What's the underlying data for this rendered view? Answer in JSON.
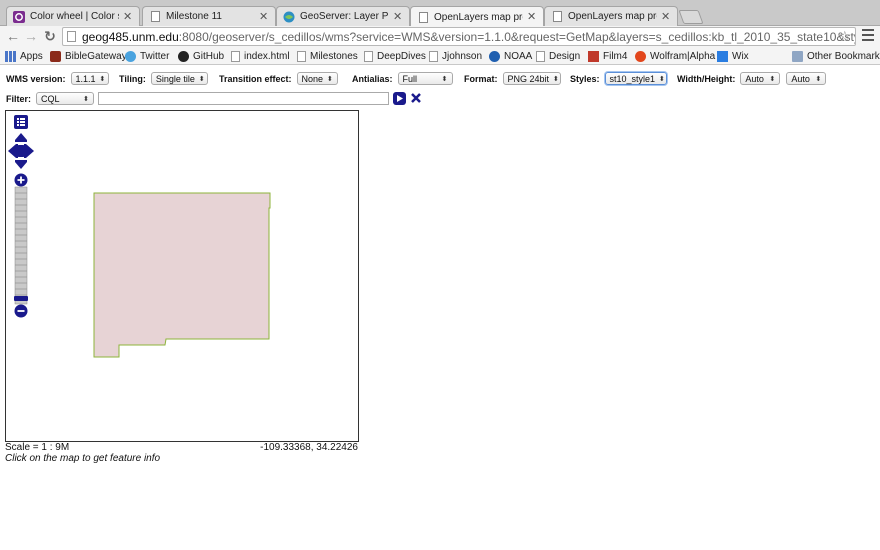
{
  "tabs": [
    {
      "title": "Color wheel | Color scheme",
      "icon": "color-wheel-icon",
      "active": false
    },
    {
      "title": "Milestone 11",
      "icon": "document-icon",
      "active": false
    },
    {
      "title": "GeoServer: Layer Preview",
      "icon": "geoserver-icon",
      "active": false
    },
    {
      "title": "OpenLayers map preview",
      "icon": "document-icon",
      "active": true
    },
    {
      "title": "OpenLayers map preview",
      "icon": "document-icon",
      "active": false
    }
  ],
  "toolbar": {
    "url_host": "geog485.unm.edu",
    "url_rest": ":8080/geoserver/s_cedillos/wms?service=WMS&version=1.1.0&request=GetMap&layers=s_cedillos:kb_tl_2010_35_state10&styles=&bbox=..."
  },
  "bookmarks": [
    {
      "label": "Apps",
      "icon": "apps-icon"
    },
    {
      "label": "BibleGateway",
      "icon": "biblegateway-icon"
    },
    {
      "label": "Twitter",
      "icon": "twitter-icon"
    },
    {
      "label": "GitHub",
      "icon": "github-icon"
    },
    {
      "label": "index.html",
      "icon": "document-icon"
    },
    {
      "label": "Milestones",
      "icon": "document-icon"
    },
    {
      "label": "DeepDives",
      "icon": "document-icon"
    },
    {
      "label": "Jjohnson",
      "icon": "document-icon"
    },
    {
      "label": "NOAA",
      "icon": "noaa-icon"
    },
    {
      "label": "Design",
      "icon": "document-icon"
    },
    {
      "label": "Film4",
      "icon": "film4-icon"
    },
    {
      "label": "Wolfram|Alpha",
      "icon": "wolfram-icon"
    },
    {
      "label": "Wix",
      "icon": "wix-icon"
    },
    {
      "label": "Other Bookmarks",
      "icon": "folder-icon"
    }
  ],
  "controls": {
    "wms_version": {
      "label": "WMS version:",
      "value": "1.1.1"
    },
    "tiling": {
      "label": "Tiling:",
      "value": "Single tile"
    },
    "transition": {
      "label": "Transition effect:",
      "value": "None"
    },
    "antialias": {
      "label": "Antialias:",
      "value": "Full"
    },
    "format": {
      "label": "Format:",
      "value": "PNG 24bit"
    },
    "styles": {
      "label": "Styles:",
      "value": "st10_style1"
    },
    "width_height": {
      "label": "Width/Height:",
      "width": "Auto",
      "height": "Auto"
    },
    "filter": {
      "label": "Filter:",
      "value": "CQL",
      "text": ""
    }
  },
  "map": {
    "scale_text": "Scale = 1 : 9M",
    "coords_text": "-109.33368, 34.22426",
    "hint_text": "Click on the map to get feature info",
    "polygon_fill": "#e7d3d5",
    "polygon_stroke": "#8db33a",
    "control_color": "#1a1a8c"
  }
}
